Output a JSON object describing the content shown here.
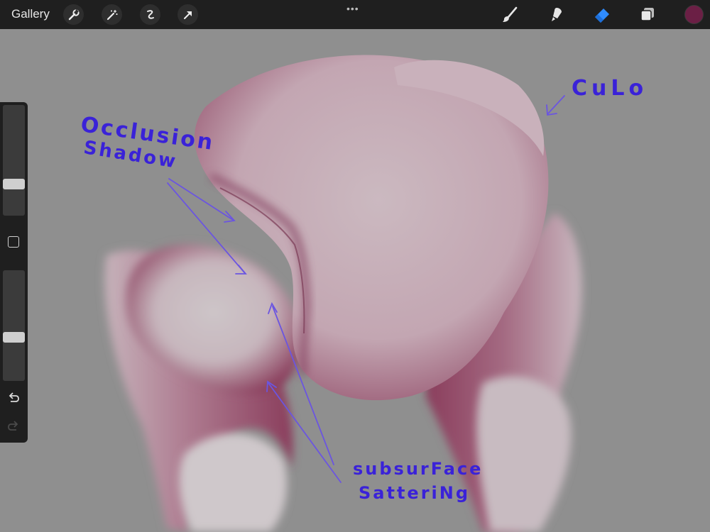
{
  "toolbar": {
    "gallery_label": "Gallery",
    "more_label": "•••",
    "left_tools": [
      "wrench-icon",
      "magic-wand-icon",
      "selection-icon",
      "transform-arrow-icon"
    ],
    "right_tools": [
      "brush-icon",
      "smudge-icon",
      "eraser-icon",
      "layers-icon"
    ],
    "active_tool": "eraser",
    "active_color": "#6b1f45",
    "active_tool_color": "#2f8cff"
  },
  "sidebar": {
    "brush_size_level": 0.26,
    "opacity_level": 0.38,
    "icons": [
      "modify-square-icon",
      "undo-icon",
      "redo-icon"
    ]
  },
  "annotations": {
    "occlusion": "Occlusion",
    "shadow": "Shadow",
    "culo": "CuLo",
    "subsurface": "subsurFace",
    "sattering": "SatteriNg"
  },
  "colors": {
    "canvas_bg": "#8f8f8f",
    "skin_light": "#cdb7c0",
    "skin_dark": "#8a3d5c",
    "ink": "#3a22d8"
  }
}
